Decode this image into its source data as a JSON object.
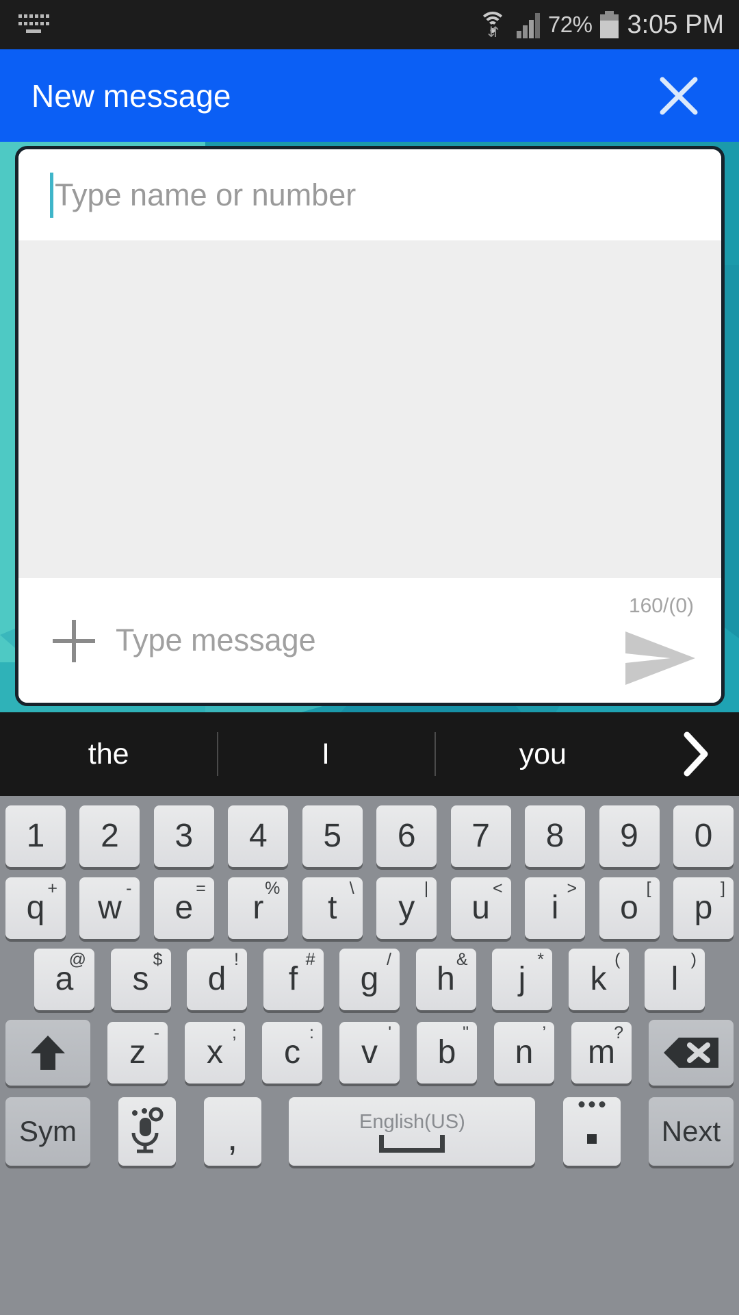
{
  "status_bar": {
    "notification_icon": "keyboard-icon",
    "wifi_icon": "wifi-icon",
    "signal_icon": "cellular-signal-icon",
    "battery_percent": "72%",
    "battery_icon": "battery-icon",
    "time": "3:05 PM"
  },
  "app_bar": {
    "title": "New message",
    "close_icon": "close-icon",
    "background_color": "#0b5ff5"
  },
  "compose": {
    "recipient_placeholder": "Type name or number",
    "recipient_value": "",
    "message_placeholder": "Type message",
    "message_value": "",
    "char_counter": "160/(0)",
    "attach_icon": "plus-icon",
    "send_icon": "send-icon"
  },
  "suggestions": {
    "items": [
      {
        "label": "the"
      },
      {
        "label": "I"
      },
      {
        "label": "you"
      }
    ],
    "expand_icon": "chevron-right-icon"
  },
  "keyboard": {
    "language": "English(US)",
    "rows": {
      "numbers": [
        {
          "main": "1"
        },
        {
          "main": "2"
        },
        {
          "main": "3"
        },
        {
          "main": "4"
        },
        {
          "main": "5"
        },
        {
          "main": "6"
        },
        {
          "main": "7"
        },
        {
          "main": "8"
        },
        {
          "main": "9"
        },
        {
          "main": "0"
        }
      ],
      "top": [
        {
          "main": "q",
          "sub": "+"
        },
        {
          "main": "w",
          "sub": "-"
        },
        {
          "main": "e",
          "sub": "="
        },
        {
          "main": "r",
          "sub": "%"
        },
        {
          "main": "t",
          "sub": "\\"
        },
        {
          "main": "y",
          "sub": "|"
        },
        {
          "main": "u",
          "sub": "<"
        },
        {
          "main": "i",
          "sub": ">"
        },
        {
          "main": "o",
          "sub": "["
        },
        {
          "main": "p",
          "sub": "]"
        }
      ],
      "home": [
        {
          "main": "a",
          "sub": "@"
        },
        {
          "main": "s",
          "sub": "$"
        },
        {
          "main": "d",
          "sub": "!"
        },
        {
          "main": "f",
          "sub": "#"
        },
        {
          "main": "g",
          "sub": "/"
        },
        {
          "main": "h",
          "sub": "&"
        },
        {
          "main": "j",
          "sub": "*"
        },
        {
          "main": "k",
          "sub": "("
        },
        {
          "main": "l",
          "sub": ")"
        }
      ],
      "bottom": [
        {
          "main": "z",
          "sub": "-"
        },
        {
          "main": "x",
          "sub": ";"
        },
        {
          "main": "c",
          "sub": ":"
        },
        {
          "main": "v",
          "sub": "'"
        },
        {
          "main": "b",
          "sub": "\""
        },
        {
          "main": "n",
          "sub": "’"
        },
        {
          "main": "m",
          "sub": "?"
        }
      ]
    },
    "shift_icon": "shift-arrow-icon",
    "backspace_icon": "backspace-icon",
    "sym_label": "Sym",
    "mic_icon": "microphone-settings-icon",
    "comma_label": ",",
    "space_icon": "space-bar-icon",
    "period_label": ".",
    "period_more_icon": "more-dots-icon",
    "next_label": "Next"
  },
  "theme": {
    "accent_blue": "#0b5ff5",
    "wallpaper_teal": "#1b9aab",
    "keyboard_bg": "#8b8e93",
    "key_face": "#e4e5e8",
    "suggestion_bg": "#181818"
  }
}
